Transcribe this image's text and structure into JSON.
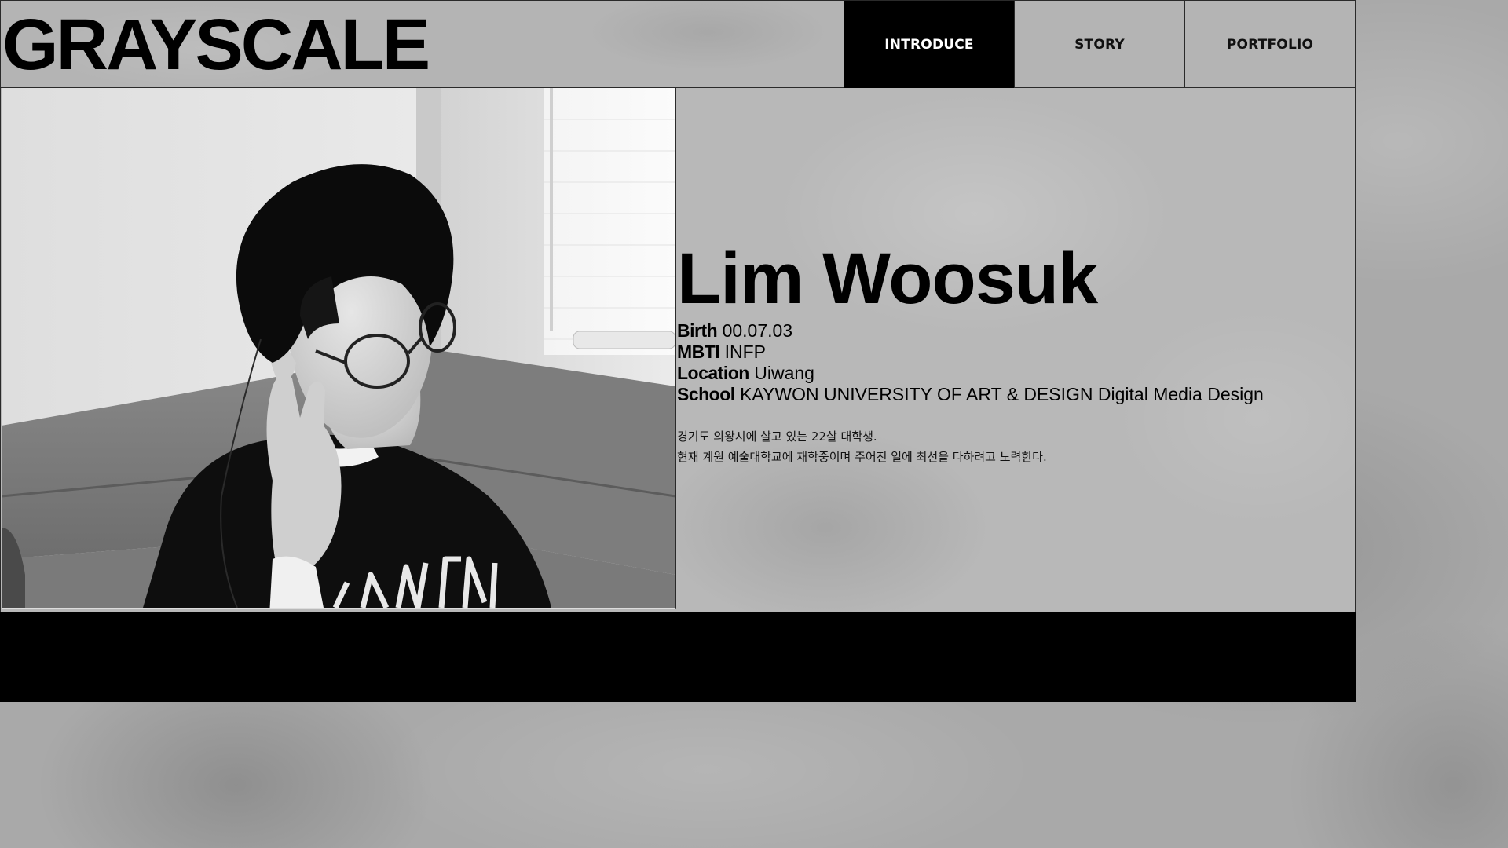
{
  "header": {
    "logo": "GRAYSCALE",
    "nav": [
      {
        "label": "INTRODUCE",
        "active": true
      },
      {
        "label": "STORY",
        "active": false
      },
      {
        "label": "PORTFOLIO",
        "active": false
      }
    ]
  },
  "profile": {
    "name": "Lim Woosuk",
    "facts": [
      {
        "label": "Birth",
        "value": "00.07.03"
      },
      {
        "label": "MBTI",
        "value": "INFP"
      },
      {
        "label": "Location",
        "value": "Uiwang"
      },
      {
        "label": "School",
        "value": "KAYWON UNIVERSITY OF ART & DESIGN Digital Media Design"
      }
    ],
    "bio": [
      "경기도 의왕시에 살고 있는 22살 대학생.",
      "현재 계원 예술대학교에 재학중이며 주어진 일에 최선을 다하려고 노력한다."
    ]
  },
  "colors": {
    "accent": "#000000",
    "nav_active_text": "#ffffff",
    "background": "#a9a9a9"
  }
}
